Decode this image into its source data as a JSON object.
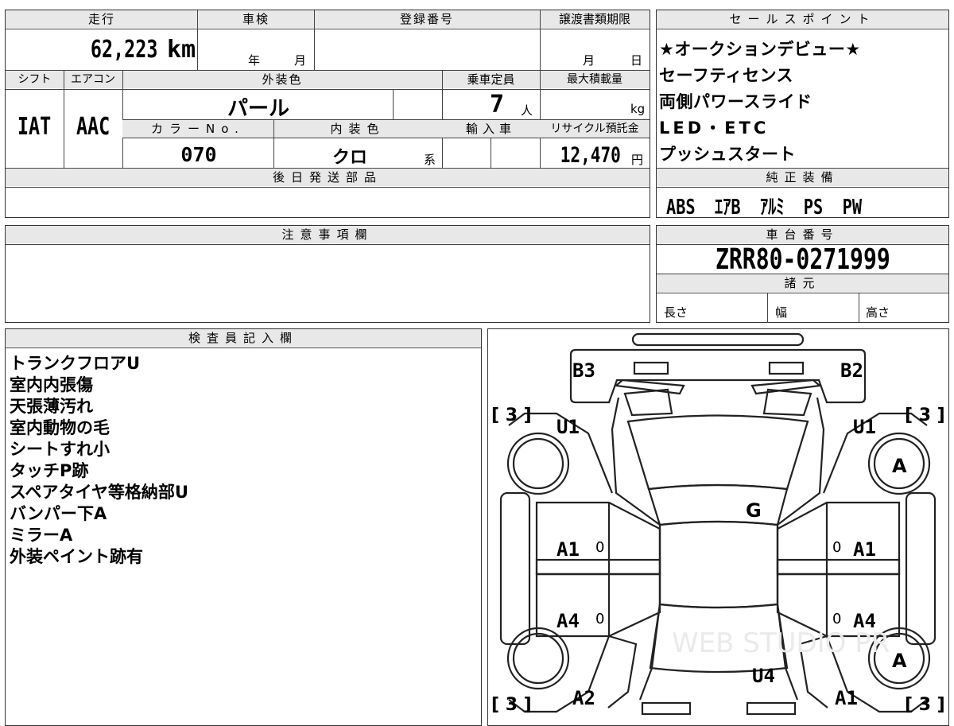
{
  "top": {
    "mileage_label": "走行",
    "inspection_label": "車検",
    "registration_label": "登録番号",
    "transfer_deadline_label": "譲渡書類期限",
    "mileage_value": "62,223",
    "mileage_unit": "km",
    "inspection_year": "年",
    "inspection_month": "月",
    "deadline_month": "月",
    "deadline_day": "日"
  },
  "mid": {
    "shift_label": "シフト",
    "aircon_label": "エアコン",
    "exterior_color_label": "外装色",
    "capacity_label": "乗車定員",
    "max_load_label": "最大積載量",
    "shift_value": "IAT",
    "aircon_value": "AAC",
    "exterior_color_value": "パール",
    "capacity_value": "7",
    "capacity_unit": "人",
    "load_unit": "kg",
    "color_no_label": "カラーNo.",
    "interior_color_label": "内装色",
    "import_label": "輸入車",
    "recycle_label": "リサイクル預託金",
    "color_no_value": "070",
    "interior_color_value": "クロ",
    "interior_color_suffix": "系",
    "recycle_value": "12,470",
    "recycle_unit": "円"
  },
  "later_parts_label": "後日発送部品",
  "sales_points": {
    "label": "セールスポイント",
    "items": [
      "★オークションデビュー★",
      "セーフティセンス",
      "両側パワースライド",
      "LED・ETC",
      "プッシュスタート"
    ]
  },
  "genuine_equipment": {
    "label": "純正装備",
    "value": "ABS  ｴｱB  ｱﾙﾐ  PS  PW"
  },
  "notes_label": "注意事項欄",
  "chassis": {
    "label": "車台番号",
    "value": "ZRR80-0271999"
  },
  "specs": {
    "label": "諸元",
    "length_label": "長さ",
    "width_label": "幅",
    "height_label": "高さ"
  },
  "inspector": {
    "label": "検査員記入欄",
    "notes": [
      "トランクフロアU",
      "室内内張傷",
      "天張薄汚れ",
      "室内動物の毛",
      "シートすれ小",
      "タッチP跡",
      "スペアタイヤ等格納部U",
      "バンパー下A",
      "ミラーA",
      "外装ペイント跡有"
    ]
  },
  "diagram": {
    "b3": "B3",
    "b2": "B2",
    "u1_left": "U1",
    "u1_right": "U1",
    "tread_left_top": "[ 3 ]",
    "tread_right_top": "[ 3 ]",
    "tread_left_bottom": "[ 3 ]",
    "tread_right_bottom": "[ 3 ]",
    "wheel_right_top": "A",
    "wheel_right_bottom": "A",
    "g": "G",
    "a1_left": "A1",
    "a1_right": "A1",
    "a4_left": "A4",
    "a4_right": "A4",
    "u4": "U4",
    "a2": "A2",
    "a1_bottom": "A1",
    "zero": "0",
    "watermark": "WEB STUDIO PR"
  }
}
